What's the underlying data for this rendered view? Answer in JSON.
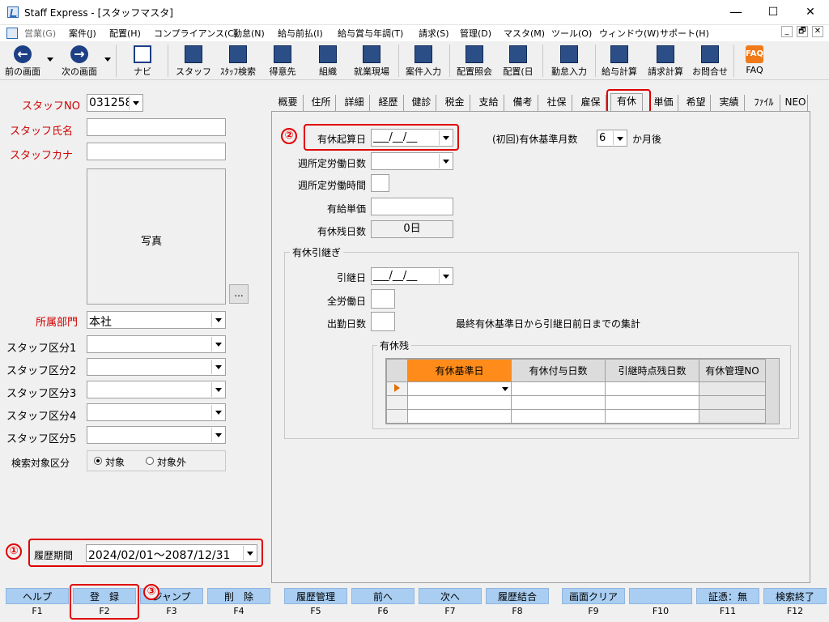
{
  "window": {
    "title": "Staff Express - [スタッフマスタ]",
    "minimize": "—",
    "maximize": "☐",
    "close": "✕"
  },
  "menu": {
    "items": [
      "営業(G)",
      "案件(J)",
      "配置(H)",
      "コンプライアンス(C)",
      "勤怠(N)",
      "給与前払(I)",
      "給与賞与年調(T)",
      "請求(S)",
      "管理(D)",
      "マスタ(M)",
      "ツール(O)",
      "ウィンドウ(W)",
      "サポート(H)"
    ],
    "mdi": [
      "_",
      "🗗",
      "✕"
    ]
  },
  "toolbar": {
    "buttons": [
      {
        "label": "前の画面",
        "icon": "back-arrow-icon"
      },
      {
        "label": "次の画面",
        "icon": "forward-arrow-icon"
      },
      {
        "label": "ナビ",
        "icon": "navi-icon"
      },
      {
        "label": "スタッフ",
        "icon": "staff-icon"
      },
      {
        "label": "ｽﾀｯﾌ検索",
        "icon": "staff-search-icon"
      },
      {
        "label": "得意先",
        "icon": "customer-icon"
      },
      {
        "label": "組織",
        "icon": "organization-icon"
      },
      {
        "label": "就業現場",
        "icon": "worksite-icon"
      },
      {
        "label": "案件入力",
        "icon": "project-entry-icon"
      },
      {
        "label": "配置照会",
        "icon": "placement-inquiry-icon"
      },
      {
        "label": "配置(日",
        "icon": "placement-daily-icon"
      },
      {
        "label": "勤怠入力",
        "icon": "attendance-entry-icon"
      },
      {
        "label": "給与計算",
        "icon": "payroll-icon"
      },
      {
        "label": "請求計算",
        "icon": "billing-icon"
      },
      {
        "label": "お問合せ",
        "icon": "inquiry-icon"
      },
      {
        "label": "FAQ",
        "icon": "faq-icon"
      }
    ]
  },
  "left": {
    "staff_no_label": "スタッフNO",
    "staff_no_value": "031258",
    "staff_name_label": "スタッフ氏名",
    "staff_kana_label": "スタッフカナ",
    "photo_label": "写真",
    "photo_button": "...",
    "dept_label": "所属部門",
    "dept_value": "本社",
    "class_labels": [
      "スタッフ区分1",
      "スタッフ区分2",
      "スタッフ区分3",
      "スタッフ区分4",
      "スタッフ区分5"
    ],
    "search_target_label": "検索対象区分",
    "radio_target": "対象",
    "radio_non_target": "対象外",
    "history_label": "履歴期間",
    "history_value": "2024/02/01～2087/12/31"
  },
  "tabs": [
    "概要",
    "住所",
    "詳細",
    "経歴",
    "健診",
    "税金",
    "支給",
    "備考",
    "社保",
    "雇保",
    "有休",
    "単価",
    "希望",
    "実績",
    "ﾌｧｲﾙ",
    "NEO"
  ],
  "active_tab": "有休",
  "paid_leave": {
    "start_date_label": "有休起算日",
    "start_date_value": "___/__/__",
    "base_months_label": "(初回)有休基準月数",
    "base_months_value": "6",
    "base_months_suffix": "か月後",
    "weekly_days_label": "週所定労働日数",
    "weekly_hours_label": "週所定労働時間",
    "unit_price_label": "有給単価",
    "remaining_label": "有休残日数",
    "remaining_value": "0日",
    "carryover_title": "有休引継ぎ",
    "carry_date_label": "引継日",
    "carry_date_value": "___/__/__",
    "total_work_label": "全労働日",
    "attendance_label": "出勤日数",
    "aggregate_note": "最終有休基準日から引継日前日までの集計",
    "balance_title": "有休残",
    "grid_headers": [
      "有休基準日",
      "有休付与日数",
      "引継時点残日数",
      "有休管理NO"
    ]
  },
  "markers": [
    "①",
    "②",
    "③"
  ],
  "fkeys": [
    {
      "label": "ヘルプ",
      "key": "F1"
    },
    {
      "label": "登　録",
      "key": "F2"
    },
    {
      "label": "ジャンプ",
      "key": "F3"
    },
    {
      "label": "削　除",
      "key": "F4"
    },
    {
      "label": "履歴管理",
      "key": "F5"
    },
    {
      "label": "前へ",
      "key": "F6"
    },
    {
      "label": "次へ",
      "key": "F7"
    },
    {
      "label": "履歴結合",
      "key": "F8"
    },
    {
      "label": "画面クリア",
      "key": "F9"
    },
    {
      "label": "",
      "key": "F10"
    },
    {
      "label": "証憑：無",
      "key": "F11"
    },
    {
      "label": "検索終了",
      "key": "F12"
    }
  ],
  "colors": {
    "required_label": "#d00000",
    "fkey_bg": "#a9cef2",
    "grid_header_active": "#ff8c1a",
    "annotation": "#e00000"
  }
}
